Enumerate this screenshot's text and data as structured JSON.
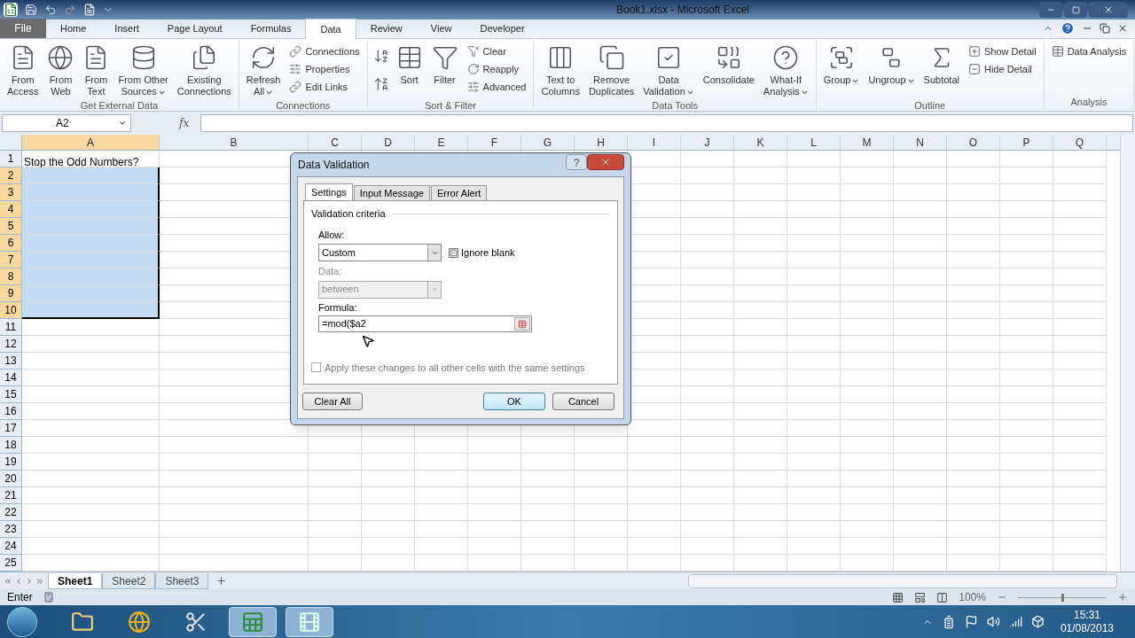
{
  "window": {
    "title": "Book1.xlsx  -  Microsoft Excel"
  },
  "ribbon_tabs": [
    {
      "label": "File",
      "kind": "file",
      "selected": false
    },
    {
      "label": "Home",
      "kind": "tab",
      "selected": false
    },
    {
      "label": "Insert",
      "kind": "tab",
      "selected": false
    },
    {
      "label": "Page Layout",
      "kind": "tab",
      "selected": false
    },
    {
      "label": "Formulas",
      "kind": "tab",
      "selected": false
    },
    {
      "label": "Data",
      "kind": "tab",
      "selected": true
    },
    {
      "label": "Review",
      "kind": "tab",
      "selected": false
    },
    {
      "label": "View",
      "kind": "tab",
      "selected": false
    },
    {
      "label": "Developer",
      "kind": "tab",
      "selected": false
    }
  ],
  "ribbon_groups": [
    {
      "label": "Get External Data",
      "items": [
        {
          "kind": "large",
          "label": "From\nAccess",
          "dropdown": false
        },
        {
          "kind": "large",
          "label": "From\nWeb",
          "dropdown": false
        },
        {
          "kind": "large",
          "label": "From\nText",
          "dropdown": false
        },
        {
          "kind": "large",
          "label": "From Other\nSources",
          "dropdown": true
        },
        {
          "kind": "large",
          "label": "Existing\nConnections",
          "dropdown": false
        }
      ]
    },
    {
      "label": "Connections",
      "items": [
        {
          "kind": "large",
          "label": "Refresh\nAll",
          "dropdown": true
        },
        {
          "kind": "small",
          "label": "Connections"
        },
        {
          "kind": "small",
          "label": "Properties"
        },
        {
          "kind": "small",
          "label": "Edit Links"
        }
      ]
    },
    {
      "label": "Sort & Filter",
      "items": [
        {
          "kind": "icon"
        },
        {
          "kind": "icon"
        },
        {
          "kind": "large",
          "label": "Sort",
          "dropdown": false
        },
        {
          "kind": "large",
          "label": "Filter",
          "dropdown": false
        },
        {
          "kind": "small",
          "label": "Clear"
        },
        {
          "kind": "small",
          "label": "Reapply"
        },
        {
          "kind": "small",
          "label": "Advanced"
        }
      ]
    },
    {
      "label": "Data Tools",
      "items": [
        {
          "kind": "large",
          "label": "Text to\nColumns",
          "dropdown": false
        },
        {
          "kind": "large",
          "label": "Remove\nDuplicates",
          "dropdown": false
        },
        {
          "kind": "large",
          "label": "Data\nValidation",
          "dropdown": true
        },
        {
          "kind": "large",
          "label": "Consolidate",
          "dropdown": false
        },
        {
          "kind": "large",
          "label": "What-If\nAnalysis",
          "dropdown": true
        }
      ]
    },
    {
      "label": "Outline",
      "items": [
        {
          "kind": "large",
          "label": "Group",
          "dropdown": true
        },
        {
          "kind": "large",
          "label": "Ungroup",
          "dropdown": true
        },
        {
          "kind": "large",
          "label": "Subtotal",
          "dropdown": false
        },
        {
          "kind": "small",
          "label": "Show Detail"
        },
        {
          "kind": "small",
          "label": "Hide Detail"
        }
      ]
    },
    {
      "label": "Analysis",
      "items": [
        {
          "kind": "small",
          "label": "Data Analysis"
        }
      ]
    }
  ],
  "name_box": "A2",
  "formula_label": "fx",
  "sheet": {
    "columns": [
      {
        "label": "A",
        "selected": true
      },
      {
        "label": "B",
        "selected": false
      },
      {
        "label": "C",
        "selected": false
      },
      {
        "label": "D",
        "selected": false
      },
      {
        "label": "E",
        "selected": false
      },
      {
        "label": "F",
        "selected": false
      },
      {
        "label": "G",
        "selected": false
      },
      {
        "label": "H",
        "selected": false
      },
      {
        "label": "I",
        "selected": false
      },
      {
        "label": "J",
        "selected": false
      },
      {
        "label": "K",
        "selected": false
      },
      {
        "label": "L",
        "selected": false
      },
      {
        "label": "M",
        "selected": false
      },
      {
        "label": "N",
        "selected": false
      },
      {
        "label": "O",
        "selected": false
      },
      {
        "label": "P",
        "selected": false
      },
      {
        "label": "Q",
        "selected": false
      }
    ],
    "rows": [
      {
        "number": "1",
        "selected": false,
        "a": "Stop the Odd Numbers?"
      },
      {
        "number": "2",
        "selected": true
      },
      {
        "number": "3",
        "selected": true
      },
      {
        "number": "4",
        "selected": true
      },
      {
        "number": "5",
        "selected": true
      },
      {
        "number": "6",
        "selected": true
      },
      {
        "number": "7",
        "selected": true
      },
      {
        "number": "8",
        "selected": true
      },
      {
        "number": "9",
        "selected": true
      },
      {
        "number": "10",
        "selected": true
      },
      {
        "number": "11",
        "selected": false
      },
      {
        "number": "12",
        "selected": false
      },
      {
        "number": "13",
        "selected": false
      },
      {
        "number": "14",
        "selected": false
      },
      {
        "number": "15",
        "selected": false
      },
      {
        "number": "16",
        "selected": false
      },
      {
        "number": "17",
        "selected": false
      },
      {
        "number": "18",
        "selected": false
      },
      {
        "number": "19",
        "selected": false
      },
      {
        "number": "20",
        "selected": false
      },
      {
        "number": "21",
        "selected": false
      },
      {
        "number": "22",
        "selected": false
      },
      {
        "number": "23",
        "selected": false
      },
      {
        "number": "24",
        "selected": false
      },
      {
        "number": "25",
        "selected": false
      }
    ]
  },
  "sheet_tabs": [
    {
      "label": "Sheet1",
      "selected": true
    },
    {
      "label": "Sheet2",
      "selected": false
    },
    {
      "label": "Sheet3",
      "selected": false
    }
  ],
  "status_bar": {
    "mode": "Enter",
    "zoom": "100%",
    "zoom_slider": {
      "level": 0.5
    }
  },
  "dialog": {
    "title": "Data Validation",
    "help": "?",
    "tabs": [
      {
        "label": "Settings",
        "selected": true
      },
      {
        "label": "Input Message",
        "selected": false
      },
      {
        "label": "Error Alert",
        "selected": false
      }
    ],
    "section": "Validation criteria",
    "allow_label": "Allow:",
    "allow_value": "Custom",
    "ignore_blank": {
      "label": "Ignore blank",
      "checked": true
    },
    "data_label": "Data:",
    "data_value": "between",
    "data_disabled": true,
    "formula_label": "Formula:",
    "formula_value": "=mod($a2",
    "apply_all": {
      "label": "Apply these changes to all other cells with the same settings",
      "checked": false
    },
    "buttons": [
      {
        "label": "Clear All",
        "kind": "left"
      },
      {
        "label": "OK",
        "kind": "default"
      },
      {
        "label": "Cancel",
        "kind": "normal"
      }
    ]
  },
  "taskbar": {
    "apps": [
      {
        "active": false
      },
      {
        "active": false
      },
      {
        "active": false
      },
      {
        "active": true
      },
      {
        "active": true
      }
    ],
    "time": "15:31",
    "date": "01/08/2013"
  }
}
